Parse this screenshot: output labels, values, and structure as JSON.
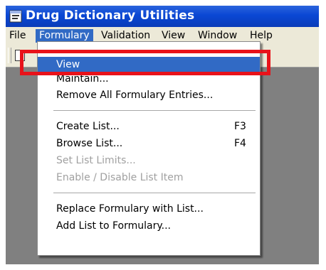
{
  "app": {
    "title": "Drug Dictionary Utilities"
  },
  "menubar": {
    "items": [
      "File",
      "Formulary",
      "Validation",
      "View",
      "Window",
      "Help"
    ]
  },
  "formulary_menu": {
    "view": "View",
    "maintain": "Maintain...",
    "remove_all": "Remove All Formulary Entries...",
    "create_list": "Create List...",
    "create_list_shortcut": "F3",
    "browse_list": "Browse List...",
    "browse_list_shortcut": "F4",
    "set_list_limits": "Set List Limits...",
    "enable_disable": "Enable / Disable List Item",
    "replace_formulary": "Replace Formulary with List...",
    "add_list": "Add List to Formulary..."
  },
  "colors": {
    "titlebar": "#0a47d4",
    "menu_highlight": "#316ac5",
    "annotation_box": "#e8121a",
    "workspace": "#808080"
  }
}
